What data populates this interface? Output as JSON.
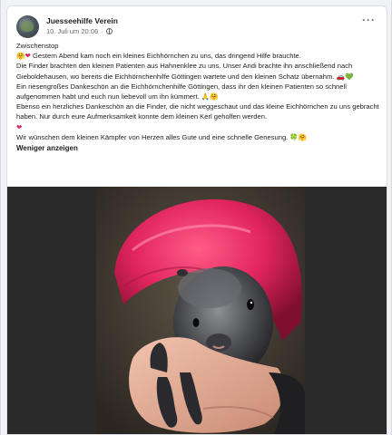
{
  "post": {
    "author": "Juesseehilfe Verein",
    "date": "10. Juli um 20:06",
    "date_separator": "·",
    "more_label": "···",
    "paragraphs": [
      "Zwischenstop",
      "Gestern Abend kam noch ein kleines Eichhörnchen zu uns, das dringend Hilfe brauchte.",
      "Die Finder brachten den kleinen Patienten aus Hahnenklee zu uns. Unser Andi brachte ihn anschließend nach Gieboldehausen, wo bereits die Eichhörnchenhilfe Göttingen wartete und den kleinen Schatz übernahm.",
      "Ein riesengroßes Dankeschön an die Eichhörnchenhilfe Göttingen, dass ihr den kleinen Patienten so schnell aufgenommen habt und euch nun liebevoll um ihn kümmert.",
      "Ebenso ein herzliches Dankeschön an die Finder, die nicht weggeschaut und das kleine Eichhörnchen zu uns gebracht haben. Nur durch eure Aufmerksamkeit konnte dem kleinen Kerl geholfen werden.",
      "Wir wünschen dem kleinen Kämpfer von Herzen alles Gute und eine schnelle Genesung."
    ],
    "see_less": "Weniger anzeigen"
  },
  "icons": {
    "hug": "🤗",
    "heart": "❤",
    "car": "🚗",
    "green_heart": "💚",
    "pray": "🙏",
    "clover": "🍀"
  },
  "colors": {
    "accent_text": "#1c1e21",
    "muted_text": "#65676b",
    "photo_background": "#2a2a2a",
    "blanket": "#d81b4a"
  }
}
